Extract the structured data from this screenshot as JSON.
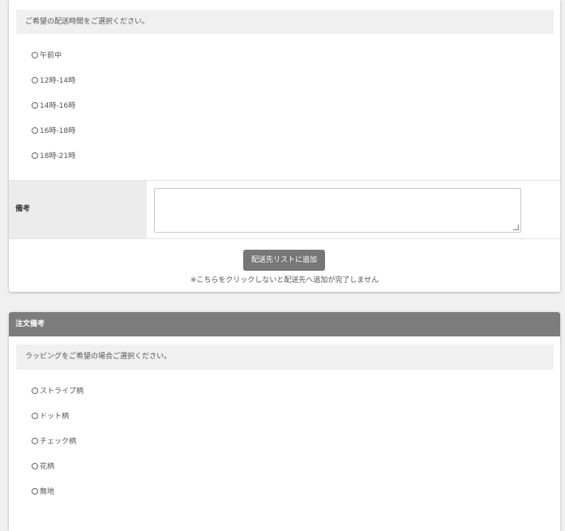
{
  "delivery": {
    "time_note": "ご希望の配送時間をご選択ください。",
    "time_options": [
      "午前中",
      "12時-14時",
      "14時-16時",
      "16時-18時",
      "18時-21時"
    ],
    "memo_label": "備考",
    "memo_value": "",
    "add_button": "配送先リストに追加",
    "add_note": "※こちらをクリックしないと配送先へ追加が完了しません"
  },
  "order_note": {
    "title": "注文備考",
    "wrapping_note": "ラッピングをご希望の場合ご選択ください。",
    "wrapping_options": [
      "ストライプ柄",
      "ドット柄",
      "チェック柄",
      "花柄",
      "無地"
    ]
  }
}
